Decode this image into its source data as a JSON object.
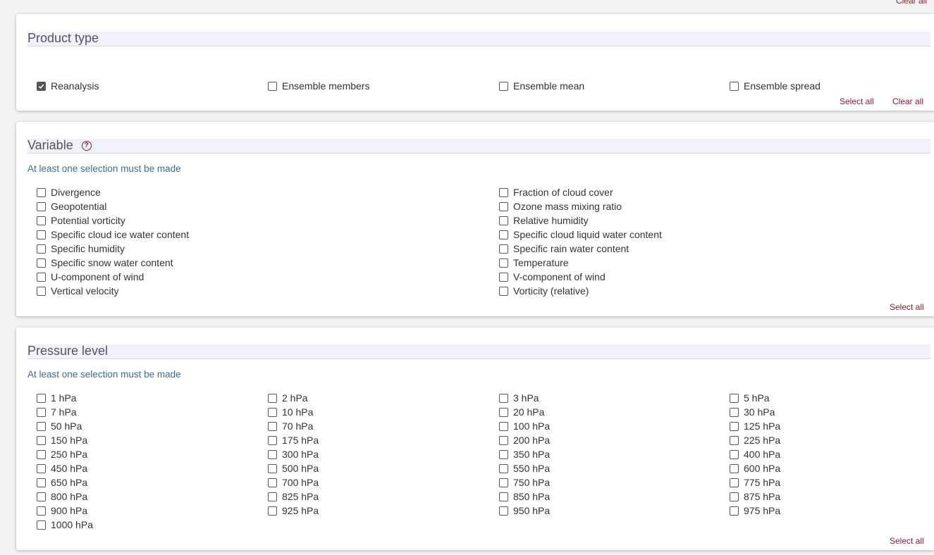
{
  "top_clear_label": "Clear all",
  "product": {
    "title": "Product type",
    "options": [
      {
        "label": "Reanalysis",
        "checked": true
      },
      {
        "label": "Ensemble members",
        "checked": false
      },
      {
        "label": "Ensemble mean",
        "checked": false
      },
      {
        "label": "Ensemble spread",
        "checked": false
      }
    ],
    "select_all": "Select all",
    "clear_all": "Clear all"
  },
  "variable": {
    "title": "Variable",
    "hint": "At least one selection must be made",
    "left": [
      "Divergence",
      "Geopotential",
      "Potential vorticity",
      "Specific cloud ice water content",
      "Specific humidity",
      "Specific snow water content",
      "U-component of wind",
      "Vertical velocity"
    ],
    "right": [
      "Fraction of cloud cover",
      "Ozone mass mixing ratio",
      "Relative humidity",
      "Specific cloud liquid water content",
      "Specific rain water content",
      "Temperature",
      "V-component of wind",
      "Vorticity (relative)"
    ],
    "select_all": "Select all"
  },
  "pressure": {
    "title": "Pressure level",
    "hint": "At least one selection must be made",
    "levels": [
      "1 hPa",
      "2 hPa",
      "3 hPa",
      "5 hPa",
      "7 hPa",
      "10 hPa",
      "20 hPa",
      "30 hPa",
      "50 hPa",
      "70 hPa",
      "100 hPa",
      "125 hPa",
      "150 hPa",
      "175 hPa",
      "200 hPa",
      "225 hPa",
      "250 hPa",
      "300 hPa",
      "350 hPa",
      "400 hPa",
      "450 hPa",
      "500 hPa",
      "550 hPa",
      "600 hPa",
      "650 hPa",
      "700 hPa",
      "750 hPa",
      "775 hPa",
      "800 hPa",
      "825 hPa",
      "850 hPa",
      "875 hPa",
      "900 hPa",
      "925 hPa",
      "950 hPa",
      "975 hPa",
      "1000 hPa"
    ],
    "select_all": "Select all"
  }
}
